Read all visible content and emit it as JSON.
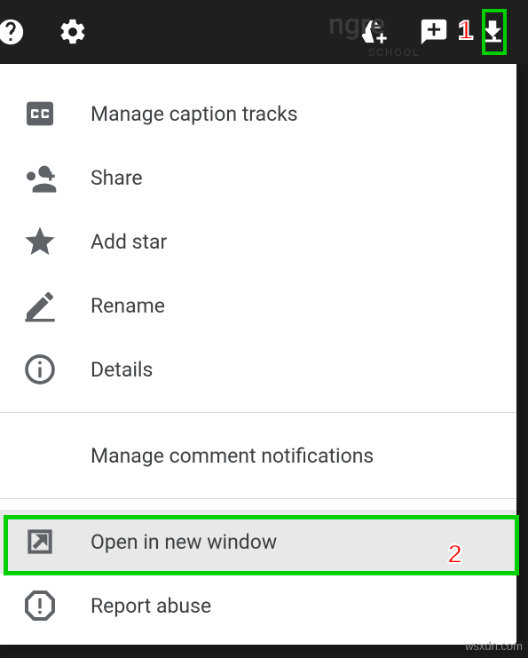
{
  "topbar": {
    "bg_word": "ngre",
    "bg_sub": "SCHOOL"
  },
  "callouts": {
    "c1": "1",
    "c2": "2"
  },
  "menu": {
    "items": [
      {
        "label": "Manage caption tracks",
        "icon": "cc"
      },
      {
        "label": "Share",
        "icon": "share"
      },
      {
        "label": "Add star",
        "icon": "star"
      },
      {
        "label": "Rename",
        "icon": "rename"
      },
      {
        "label": "Details",
        "icon": "info"
      }
    ],
    "section2": [
      {
        "label": "Manage comment notifications",
        "icon": null
      }
    ],
    "section3": [
      {
        "label": "Open in new window",
        "icon": "open"
      },
      {
        "label": "Report abuse",
        "icon": "report"
      }
    ]
  },
  "watermark": "wsxdn.com"
}
